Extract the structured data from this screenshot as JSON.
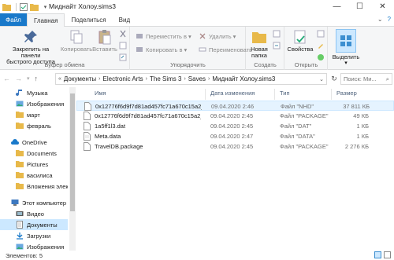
{
  "window": {
    "title": "Миднайт Холоу.sims3",
    "minimize": "—",
    "maximize": "☐",
    "close": "✕"
  },
  "tabs": [
    {
      "label": "Файл"
    },
    {
      "label": "Главная"
    },
    {
      "label": "Поделиться"
    },
    {
      "label": "Вид"
    }
  ],
  "ribbon": {
    "clipboard": {
      "pin_label_1": "Закрепить на панели",
      "pin_label_2": "быстрого доступа",
      "copy": "Копировать",
      "paste": "Вставить",
      "group": "Буфер обмена"
    },
    "organize": {
      "move_to": "Переместить в",
      "copy_to": "Копировать в",
      "delete": "Удалить",
      "rename": "Переименовать",
      "group": "Упорядочить"
    },
    "create": {
      "new_folder_1": "Новая",
      "new_folder_2": "папка",
      "group": "Создать"
    },
    "open": {
      "properties": "Свойства",
      "group": "Открыть"
    },
    "select": {
      "select": "Выделить"
    }
  },
  "address": {
    "crumbs": [
      "Документы",
      "Electronic Arts",
      "The Sims 3",
      "Saves",
      "Миднайт Холоу.sims3"
    ],
    "search_placeholder": "Поиск: Ми..."
  },
  "nav_pane": {
    "items": [
      {
        "label": "Музыка",
        "icon": "music-icon"
      },
      {
        "label": "Изображения",
        "icon": "pictures-icon"
      },
      {
        "label": "март",
        "icon": "folder-icon"
      },
      {
        "label": "февраль",
        "icon": "folder-icon"
      },
      {
        "label": "OneDrive",
        "icon": "cloud-icon"
      },
      {
        "label": "Documents",
        "icon": "folder-icon"
      },
      {
        "label": "Pictures",
        "icon": "folder-icon"
      },
      {
        "label": "василиса",
        "icon": "folder-icon"
      },
      {
        "label": "Вложения элект",
        "icon": "folder-icon"
      },
      {
        "label": "Этот компьютер",
        "icon": "computer-icon"
      },
      {
        "label": "Видео",
        "icon": "video-icon"
      },
      {
        "label": "Документы",
        "icon": "documents-icon"
      },
      {
        "label": "Загрузки",
        "icon": "downloads-icon"
      },
      {
        "label": "Изображения",
        "icon": "pictures-icon"
      }
    ]
  },
  "columns": {
    "name": "Имя",
    "date": "Дата изменения",
    "type": "Тип",
    "size": "Размер"
  },
  "files": [
    {
      "name": "0x12776f6d9f7d81ad457fc71a670c15a2_0...",
      "date": "09.04.2020 2:46",
      "type": "Файл \"NHD\"",
      "size": "37 811 КБ"
    },
    {
      "name": "0x12776f6d9f7d81ad457fc71a670c15a2_0...",
      "date": "09.04.2020 2:45",
      "type": "Файл \"PACKAGE\"",
      "size": "49 КБ"
    },
    {
      "name": "1a5ff1l3.dat",
      "date": "09.04.2020 2:45",
      "type": "Файл \"DAT\"",
      "size": "1 КБ"
    },
    {
      "name": "Meta.data",
      "date": "09.04.2020 2:47",
      "type": "Файл \"DATA\"",
      "size": "1 КБ"
    },
    {
      "name": "TravelDB.package",
      "date": "09.04.2020 2:45",
      "type": "Файл \"PACKAGE\"",
      "size": "2 276 КБ"
    }
  ],
  "status": {
    "items_count": "Элементов: 5"
  },
  "colors": {
    "accent": "#1979ca",
    "selection": "#cce8ff",
    "folder": "#e8b94a"
  }
}
